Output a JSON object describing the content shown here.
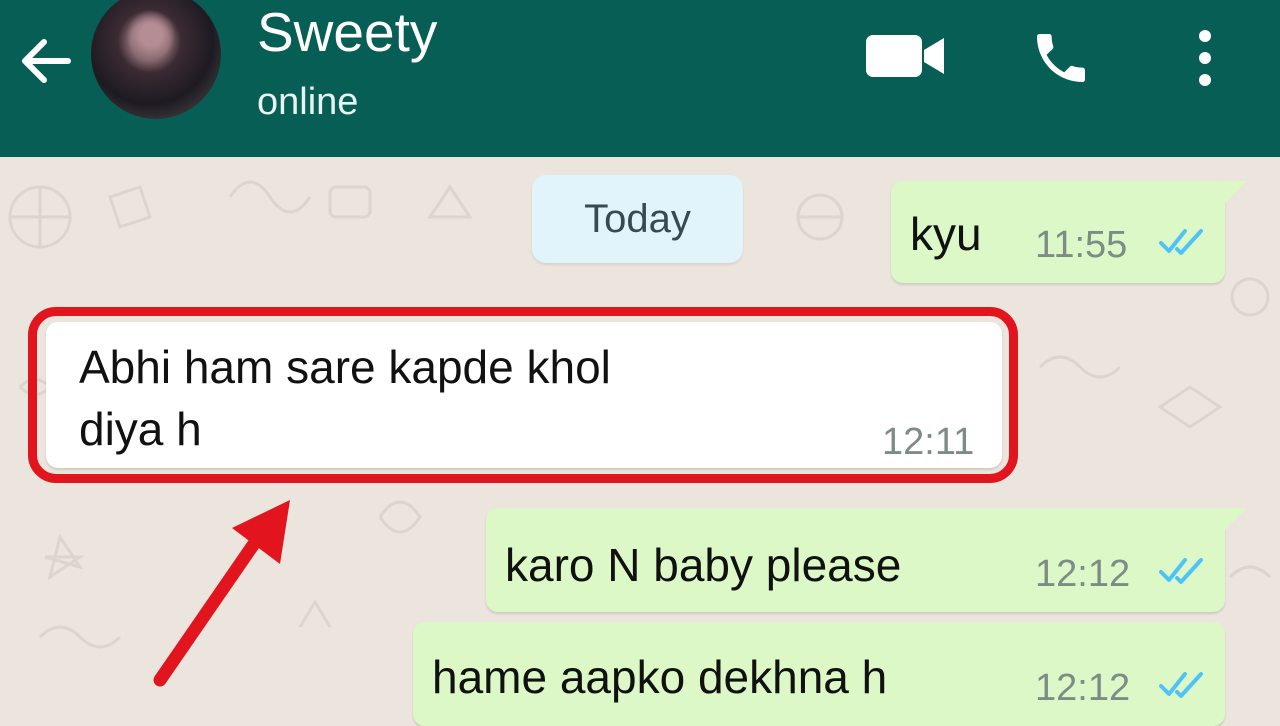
{
  "header": {
    "contact_name": "Sweety",
    "status": "online",
    "icons": [
      "back-arrow-icon",
      "video-call-icon",
      "phone-icon",
      "more-options-icon"
    ],
    "background_color": "#075e54"
  },
  "chat": {
    "date_separator": "Today",
    "messages": [
      {
        "direction": "outgoing",
        "text": "kyu",
        "time": "11:55",
        "ticks": "read"
      },
      {
        "direction": "incoming",
        "text": "Abhi ham sare kapde khol\ndiya h",
        "time": "12:11"
      },
      {
        "direction": "outgoing",
        "text": "karo N baby please",
        "time": "12:12",
        "ticks": "read"
      },
      {
        "direction": "outgoing",
        "text": "hame aapko dekhna h",
        "time": "12:12",
        "ticks": "read"
      }
    ],
    "outgoing_color": "#dcf8c6",
    "incoming_color": "#ffffff",
    "highlight_color": "#e2151f",
    "read_tick_color": "#4fc3f7"
  }
}
